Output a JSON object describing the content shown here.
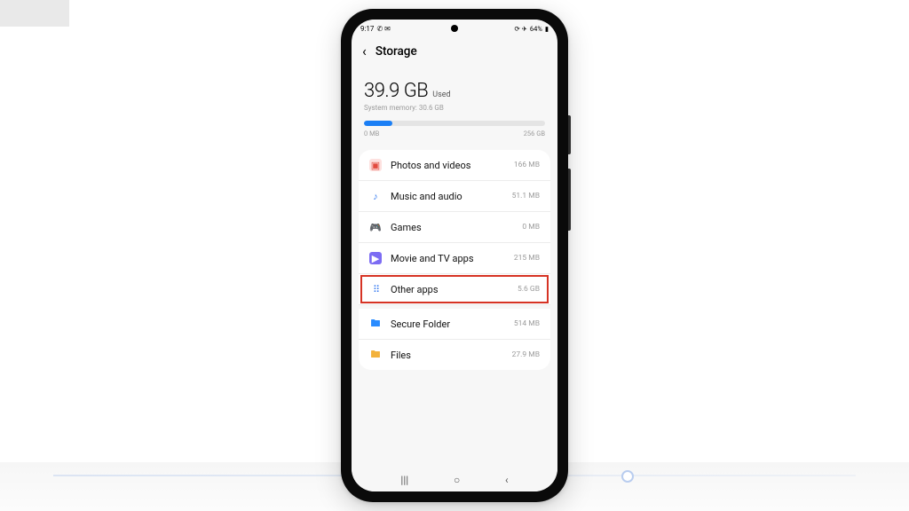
{
  "statusbar": {
    "time": "9:17",
    "left_icons": "✆ ✉",
    "right_icons": "⟳ ✈",
    "battery_text": "64%"
  },
  "header": {
    "title": "Storage"
  },
  "summary": {
    "amount": "39.9 GB",
    "used_label": "Used",
    "system_memory_label": "System memory: 30.6 GB",
    "progress_percent": 15.6,
    "scale_min": "0 MB",
    "scale_max": "256 GB"
  },
  "categories": [
    {
      "key": "photos",
      "icon": "▣",
      "icon_class": "ic-photos",
      "label": "Photos and videos",
      "size": "166 MB",
      "highlighted": false,
      "separated": false
    },
    {
      "key": "music",
      "icon": "♪",
      "icon_class": "ic-music",
      "label": "Music and audio",
      "size": "51.1 MB",
      "highlighted": false,
      "separated": false
    },
    {
      "key": "games",
      "icon": "🎮",
      "icon_class": "ic-games",
      "label": "Games",
      "size": "0 MB",
      "highlighted": false,
      "separated": false
    },
    {
      "key": "video",
      "icon": "▶",
      "icon_class": "ic-video",
      "label": "Movie and TV apps",
      "size": "215 MB",
      "highlighted": false,
      "separated": false
    },
    {
      "key": "other",
      "icon": "⠿",
      "icon_class": "ic-other",
      "label": "Other apps",
      "size": "5.6 GB",
      "highlighted": true,
      "separated": false
    },
    {
      "key": "secure",
      "icon": "🖿",
      "icon_class": "ic-folder",
      "label": "Secure Folder",
      "size": "514 MB",
      "highlighted": false,
      "separated": true
    },
    {
      "key": "files",
      "icon": "🖿",
      "icon_class": "ic-files",
      "label": "Files",
      "size": "27.9 MB",
      "highlighted": false,
      "separated": false
    }
  ],
  "highlight_color": "#d63324",
  "navbar": {
    "recent": "|||",
    "home": "○",
    "back": "‹"
  }
}
